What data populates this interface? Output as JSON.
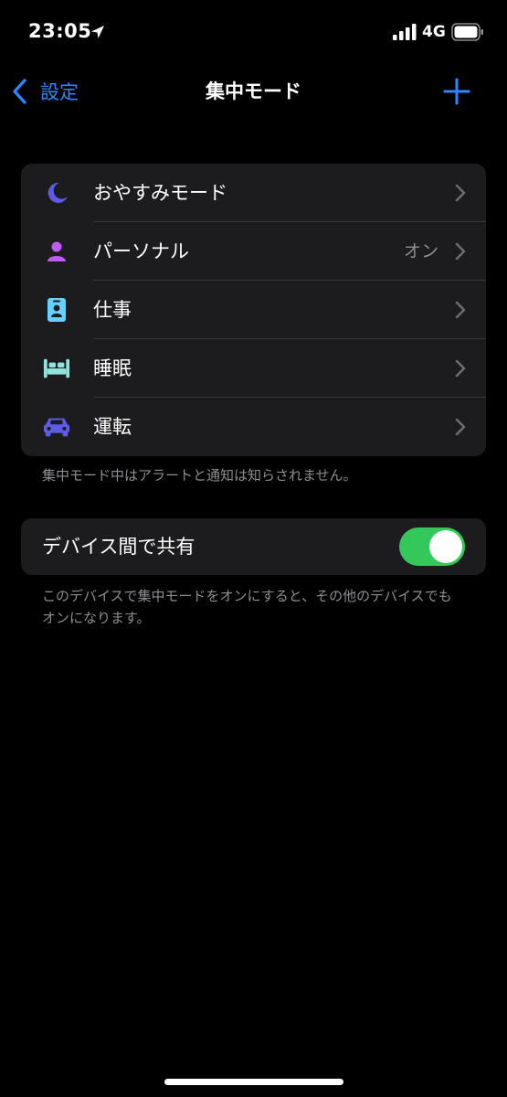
{
  "status_bar": {
    "time": "23:05",
    "network": "4G"
  },
  "nav": {
    "back_label": "設定",
    "title": "集中モード",
    "accent": "#2f86ff"
  },
  "modes": [
    {
      "label": "おやすみモード",
      "value": "",
      "icon": "moon-icon",
      "color": "#5e5ce6"
    },
    {
      "label": "パーソナル",
      "value": "オン",
      "icon": "person-icon",
      "color": "#bf5af2"
    },
    {
      "label": "仕事",
      "value": "",
      "icon": "id-badge-icon",
      "color": "#64d2ff"
    },
    {
      "label": "睡眠",
      "value": "",
      "icon": "bed-icon",
      "color": "#8fe3dc"
    },
    {
      "label": "運転",
      "value": "",
      "icon": "car-icon",
      "color": "#5e5ce6"
    }
  ],
  "modes_footnote": "集中モード中はアラートと通知は知らされません。",
  "share": {
    "label": "デバイス間で共有",
    "enabled": true,
    "toggle_color": "#34c759",
    "footnote": "このデバイスで集中モードをオンにすると、その他のデバイスでもオンになります。"
  }
}
